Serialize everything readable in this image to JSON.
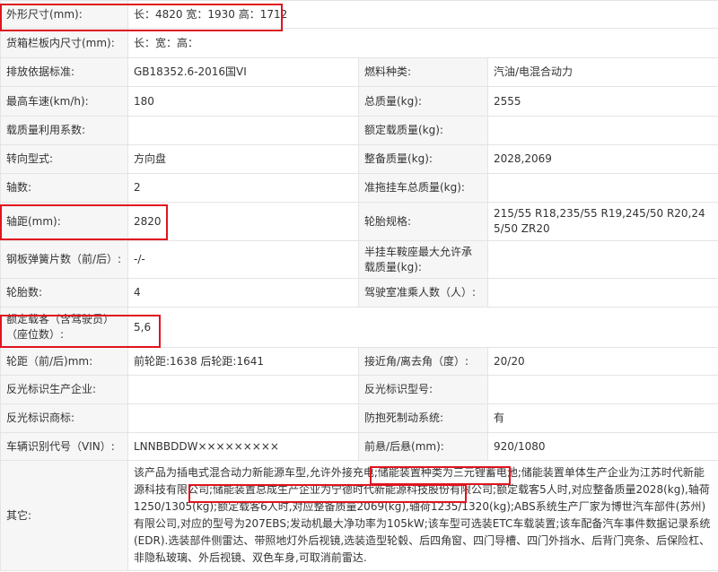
{
  "rows": [
    {
      "l1": "外形尺寸(mm):",
      "v1": "长：4820 宽：1930 高：1712",
      "l2": "",
      "v2": "",
      "span": true
    },
    {
      "l1": "货箱栏板内尺寸(mm):",
      "v1": "长：宽：高：",
      "l2": "",
      "v2": "",
      "span": true
    },
    {
      "l1": "排放依据标准:",
      "v1": "GB18352.6-2016国VI",
      "l2": "燃料种类:",
      "v2": "汽油/电混合动力"
    },
    {
      "l1": "最高车速(km/h):",
      "v1": "180",
      "l2": "总质量(kg):",
      "v2": "2555"
    },
    {
      "l1": "载质量利用系数:",
      "v1": "",
      "l2": "额定载质量(kg):",
      "v2": ""
    },
    {
      "l1": "转向型式:",
      "v1": "方向盘",
      "l2": "整备质量(kg):",
      "v2": "2028,2069"
    },
    {
      "l1": "轴数:",
      "v1": "2",
      "l2": "准拖挂车总质量(kg):",
      "v2": ""
    },
    {
      "l1": "轴距(mm):",
      "v1": "2820",
      "l2": "轮胎规格:",
      "v2": "215/55 R18,235/55 R19,245/50 R20,245/50 ZR20"
    },
    {
      "l1": "钢板弹簧片数（前/后）:",
      "v1": "-/-",
      "l2": "半挂车鞍座最大允许承载质量(kg):",
      "v2": ""
    },
    {
      "l1": "轮胎数:",
      "v1": "4",
      "l2": "驾驶室准乘人数（人）:",
      "v2": ""
    },
    {
      "l1": "额定载客（含驾驶员）（座位数）:",
      "v1": "5,6",
      "l2": "",
      "v2": "",
      "span": true
    },
    {
      "l1": "轮距（前/后)mm:",
      "v1": "前轮距:1638 后轮距:1641",
      "l2": "接近角/离去角（度）:",
      "v2": "20/20"
    },
    {
      "l1": "反光标识生产企业:",
      "v1": "",
      "l2": "反光标识型号:",
      "v2": ""
    },
    {
      "l1": "反光标识商标:",
      "v1": "",
      "l2": "防抱死制动系统:",
      "v2": "有"
    },
    {
      "l1": "车辆识别代号（VIN）:",
      "v1": "LNNBBDDW×××××××××",
      "l2": "前悬/后悬(mm):",
      "v2": "920/1080"
    }
  ],
  "other": {
    "label": "其它:",
    "text": "该产品为插电式混合动力新能源车型,允许外接充电;储能装置种类为三元锂蓄电池;储能装置单体生产企业为江苏时代新能源科技有限公司;储能装置总成生产企业为宁德时代新能源科技股份有限公司;额定载客5人时,对应整备质量2028(kg),轴荷1250/1305(kg);额定载客6人时,对应整备质量2069(kg),轴荷1235/1320(kg);ABS系统生产厂家为博世汽车部件(苏州)有限公司,对应的型号为207EBS;发动机最大净功率为105kW;该车型可选装ETC车载装置;该车配备汽车事件数据记录系统(EDR).选装部件侧雷达、带照地灯外后视镜,选装造型轮毂、后四角窗、四门导槽、四门外挡水、后背门亮条、后保险杠、非隐私玻璃、外后视镜、双色车身,可取消前雷达."
  },
  "colors": {
    "highlight": "#e0141e",
    "label_bg": "#f6f6f6",
    "border": "#e4e4e4"
  }
}
